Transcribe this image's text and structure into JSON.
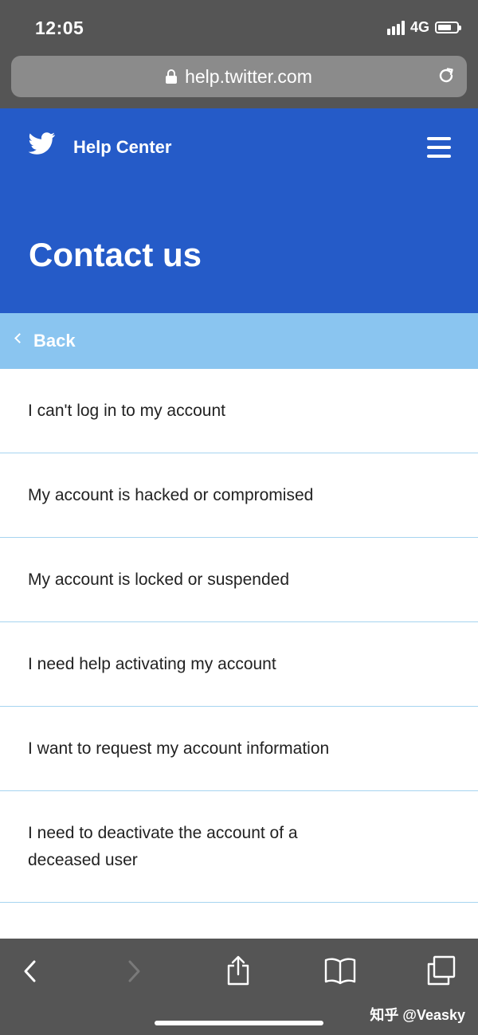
{
  "status_bar": {
    "time": "12:05",
    "network_type": "4G",
    "icons": [
      "signal-icon",
      "battery-icon"
    ]
  },
  "browser": {
    "url": "help.twitter.com",
    "icons": [
      "lock-icon",
      "reload-icon"
    ]
  },
  "header": {
    "site_name": "Help Center",
    "page_title": "Contact us",
    "icons": [
      "twitter-bird-icon",
      "hamburger-menu-icon"
    ],
    "background_color": "#255bc8"
  },
  "back": {
    "label": "Back",
    "background_color": "#8ac5f0"
  },
  "list": {
    "items": [
      {
        "label": "I can't log in to my account"
      },
      {
        "label": "My account is hacked or compromised"
      },
      {
        "label": "My account is locked or suspended"
      },
      {
        "label": "I need help activating my account"
      },
      {
        "label": "I want to request my account information"
      },
      {
        "label": "I need to deactivate the account of a deceased user"
      }
    ],
    "divider_color": "#a6d4f0"
  },
  "toolbar": {
    "icons": [
      "back-arrow-icon",
      "forward-arrow-icon",
      "share-icon",
      "bookmarks-icon",
      "tabs-icon"
    ]
  },
  "watermark": "知乎 @Veasky"
}
